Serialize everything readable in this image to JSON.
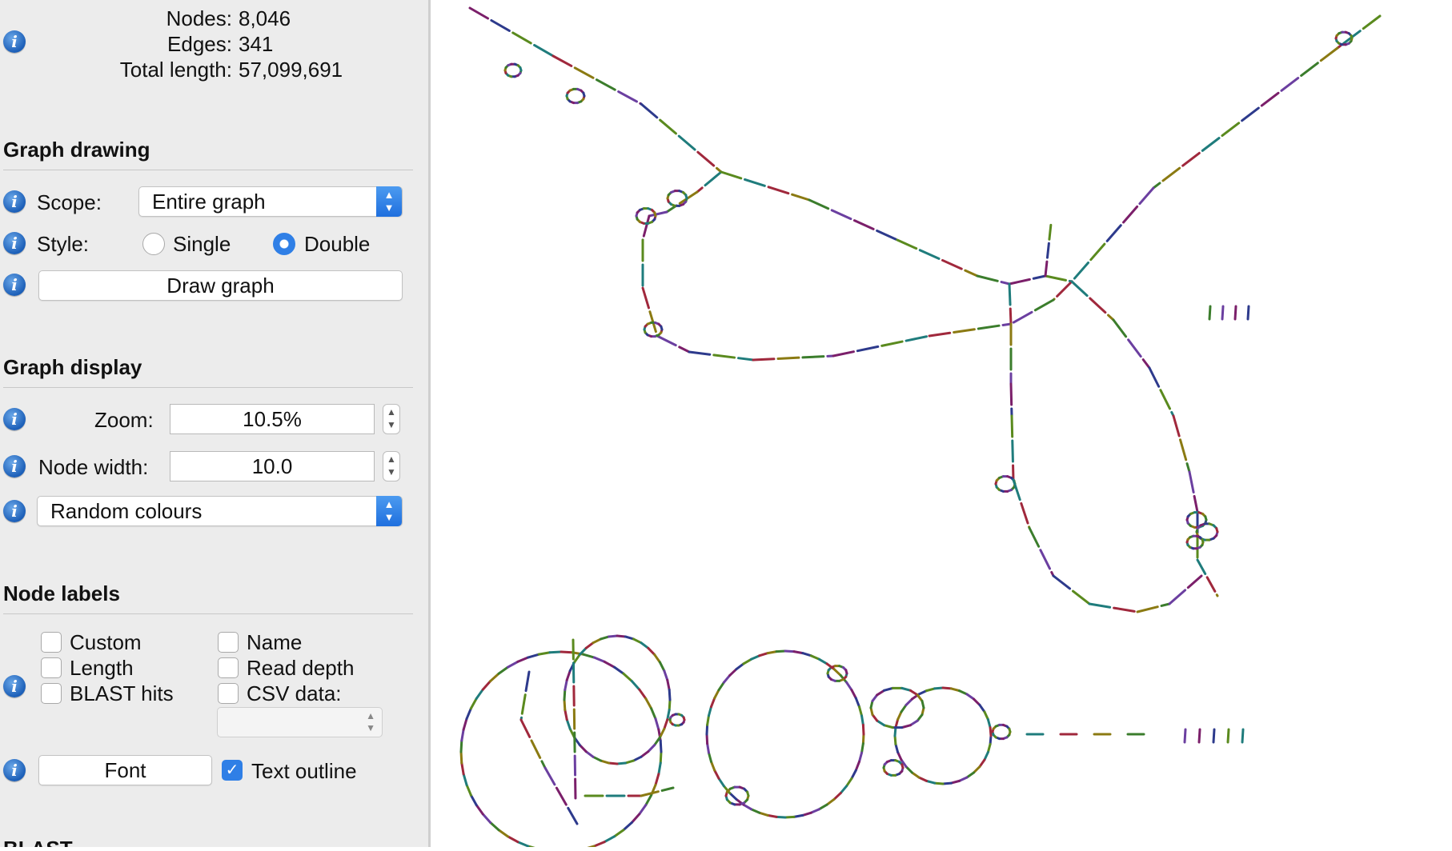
{
  "stats": {
    "nodes_label": "Nodes:",
    "nodes_value": "8,046",
    "edges_label": "Edges:",
    "edges_value": "341",
    "length_label": "Total length:",
    "length_value": "57,099,691"
  },
  "graph_drawing": {
    "title": "Graph drawing",
    "scope_label": "Scope:",
    "scope_value": "Entire graph",
    "style_label": "Style:",
    "style_single": "Single",
    "style_double": "Double",
    "style_selected": "Double",
    "draw_button": "Draw graph"
  },
  "graph_display": {
    "title": "Graph display",
    "zoom_label": "Zoom:",
    "zoom_value": "10.5%",
    "node_width_label": "Node width:",
    "node_width_value": "10.0",
    "colour_scheme": "Random colours"
  },
  "node_labels": {
    "title": "Node labels",
    "custom": "Custom",
    "length": "Length",
    "blast_hits": "BLAST hits",
    "name": "Name",
    "read_depth": "Read depth",
    "csv_data": "CSV data:",
    "font_button": "Font",
    "text_outline": "Text outline",
    "text_outline_checked": true
  },
  "blast": {
    "title": "BLAST"
  },
  "icons": {
    "info": "info-icon",
    "popup_arrows": "chevron-updown-icon",
    "stepper": "stepper-icon",
    "checkmark": "checkmark-icon"
  },
  "colors": {
    "accent": "#2f7fe6",
    "sidebar_bg": "#ececec",
    "node_palette": [
      "#7b1f6a",
      "#2d3a8c",
      "#5a8a1e",
      "#1f7c7c",
      "#a0283c",
      "#8b7a12",
      "#3b7d2c",
      "#6b3fa0"
    ]
  }
}
